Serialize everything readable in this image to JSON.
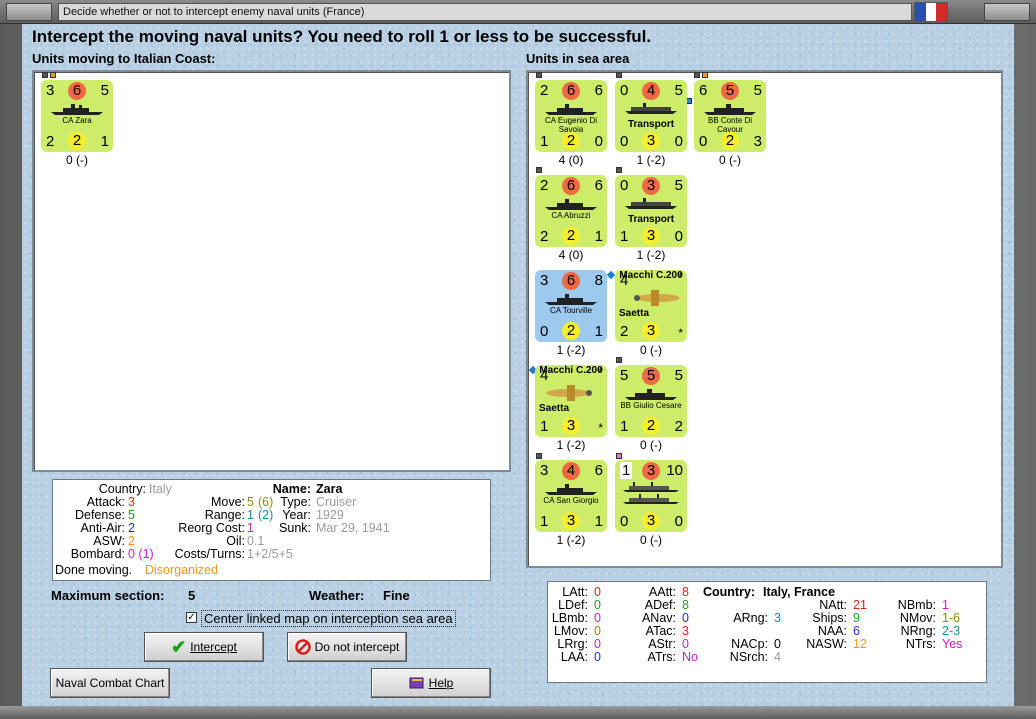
{
  "window": {
    "title": "Decide whether or not to intercept enemy naval units (France)"
  },
  "colors": {
    "counter_green": "#ccec6a",
    "counter_blue": "#9ec9ee",
    "attack_circle": "#ef6a44",
    "defense_circle": "#f5ee2c",
    "background": "#b9d0e4"
  },
  "headline": "Intercept the moving naval units?  You need to roll 1 or less to be successful.",
  "moving": {
    "label": "Units moving to Italian Coast:",
    "units": [
      {
        "name": "CA Zara",
        "tl": "3",
        "tm": "6",
        "tr": "5",
        "bl": "2",
        "bm": "2",
        "br": "1",
        "status": "0 (-)"
      }
    ]
  },
  "sea": {
    "label": "Units in sea area",
    "units": [
      {
        "name": "CA Eugenio Di Savoia",
        "tl": "2",
        "tm": "6",
        "tr": "6",
        "bl": "1",
        "bm": "2",
        "br": "0",
        "status": "4 (0)"
      },
      {
        "name": "Transport",
        "tl": "0",
        "tm": "4",
        "tr": "5",
        "bl": "0",
        "bm": "3",
        "br": "0",
        "status": "1 (-2)"
      },
      {
        "name": "BB Conte Di Cavour",
        "tl": "6",
        "tm": "5",
        "tr": "5",
        "bl": "0",
        "bm": "2",
        "br": "3",
        "status": "0 (-)"
      },
      {
        "name": "CA Abruzzi",
        "tl": "2",
        "tm": "6",
        "tr": "6",
        "bl": "2",
        "bm": "2",
        "br": "1",
        "status": "4 (0)"
      },
      {
        "name": "Transport",
        "tl": "0",
        "tm": "3",
        "tr": "5",
        "bl": "1",
        "bm": "3",
        "br": "0",
        "status": "1 (-2)"
      },
      {
        "name": "CA Tourville",
        "tl": "3",
        "tm": "6",
        "tr": "8",
        "bl": "0",
        "bm": "2",
        "br": "1",
        "status": "1 (-2)"
      },
      {
        "name": "Macchi C.200",
        "sub": "Saetta",
        "tl": "4",
        "tr": "*",
        "bl": "2",
        "bm": "3",
        "br": "*",
        "status": "0 (-)"
      },
      {
        "name": "Macchi C.200",
        "sub": "Saetta",
        "tl": "4",
        "tr": "*",
        "bl": "1",
        "bm": "3",
        "br": "*",
        "status": "1 (-2)"
      },
      {
        "name": "BB Giulio Cesare",
        "tl": "5",
        "tm": "5",
        "tr": "5",
        "bl": "1",
        "bm": "2",
        "br": "2",
        "status": "0 (-)"
      },
      {
        "name": "CA San Giorgio",
        "tl": "3",
        "tm": "4",
        "tr": "6",
        "bl": "1",
        "bm": "3",
        "br": "1",
        "status": "1 (-2)"
      },
      {
        "name": "",
        "tl": "1",
        "tm": "3",
        "tr": "10",
        "bl": "0",
        "bm": "3",
        "br": "0",
        "status": "0 (-)"
      }
    ]
  },
  "details": {
    "country_label": "Country:",
    "country": "Italy",
    "attack_label": "Attack:",
    "attack": "3",
    "defense_label": "Defense:",
    "defense": "5",
    "antiair_label": "Anti-Air:",
    "antiair": "2",
    "asw_label": "ASW:",
    "asw": "2",
    "bombard_label": "Bombard:",
    "bombard": "0 (1)",
    "done_label": "Done moving.",
    "done_status": "Disorganized",
    "name_label": "Name:",
    "name": "Zara",
    "move_label": "Move:",
    "move_a": "5",
    "move_b": "(6)",
    "type_label": "Type:",
    "type": "Cruiser",
    "range_label": "Range:",
    "range_a": "1",
    "range_b": "(2)",
    "year_label": "Year:",
    "year": "1929",
    "reorg_label": "Reorg Cost:",
    "reorg": "1",
    "sunk_label": "Sunk:",
    "sunk": "Mar 29, 1941",
    "oil_label": "Oil:",
    "oil": "0.1",
    "costs_label": "Costs/Turns:",
    "costs": "1+2/5+5"
  },
  "max_section": {
    "label": "Maximum section:",
    "value": "5"
  },
  "weather": {
    "label": "Weather:",
    "value": "Fine"
  },
  "center_map": {
    "label": "Center linked map on interception sea area",
    "checked": "✓"
  },
  "buttons": {
    "intercept": "Intercept",
    "no_intercept": "Do not intercept",
    "naval_chart": "Naval Combat Chart",
    "help": "Help"
  },
  "stats": {
    "country_label": "Country:",
    "country": "Italy, France",
    "latt_label": "LAtt:",
    "latt": "0",
    "ldef_label": "LDef:",
    "ldef": "0",
    "lbmb_label": "LBmb:",
    "lbmb": "0",
    "lmov_label": "LMov:",
    "lmov": "0",
    "lrrg_label": "LRrg:",
    "lrrg": "0",
    "laa_label": "LAA:",
    "laa": "0",
    "aatt_label": "AAtt:",
    "aatt": "8",
    "adef_label": "ADef:",
    "adef": "8",
    "anav_label": "ANav:",
    "anav": "0",
    "atac_label": "ATac:",
    "atac": "3",
    "astr_label": "AStr:",
    "astr": "0",
    "atrs_label": "ATrs:",
    "atrs": "No",
    "arng_label": "ARng:",
    "arng": "3",
    "nacp_label": "NACp:",
    "nacp": "0",
    "nsrch_label": "NSrch:",
    "nsrch": "4",
    "natt_label": "NAtt:",
    "natt": "21",
    "ships_label": "Ships:",
    "ships": "9",
    "naa_label": "NAA:",
    "naa": "6",
    "nasw_label": "NASW:",
    "nasw": "12",
    "nbmb_label": "NBmb:",
    "nbmb": "1",
    "nmov_label": "NMov:",
    "nmov": "1-6",
    "nrng_label": "NRng:",
    "nrng": "2-3",
    "ntrs_label": "NTrs:",
    "ntrs": "Yes"
  }
}
